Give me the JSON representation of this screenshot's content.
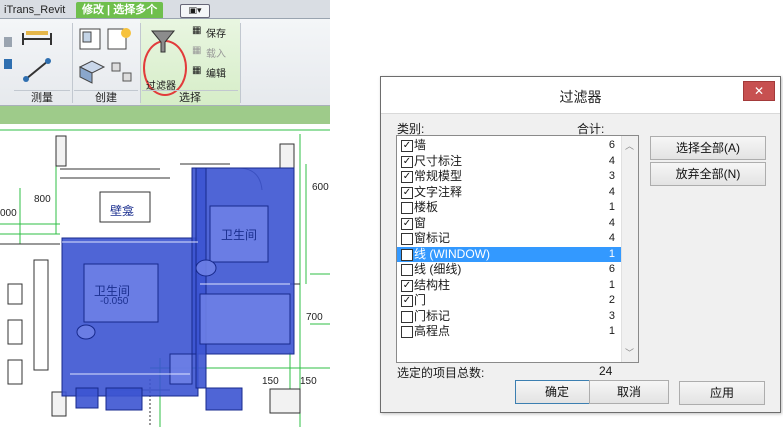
{
  "revit": {
    "tabs": {
      "addin": "iTrans_Revit",
      "modify": "修改 | 选择多个"
    },
    "ribbon": {
      "groups": {
        "measure": "测量",
        "create": "创建",
        "select": "选择"
      },
      "filter_label": "过滤器",
      "save_label": "保存",
      "load_label": "载入",
      "edit_label": "编辑"
    },
    "drawing": {
      "room_niche": "壁龛",
      "room_bath1": "卫生间",
      "room_bath2": "卫生间",
      "elev": "-0.050",
      "dim_800": "800",
      "dim_000": "000",
      "dim_600": "600",
      "dim_700": "700",
      "dim_150a": "150",
      "dim_150b": "150"
    }
  },
  "dialog": {
    "title": "过滤器",
    "close_glyph": "✕",
    "category_label": "类别:",
    "total_label": "合计:",
    "items": [
      {
        "name": "墙",
        "count": "6",
        "checked": true
      },
      {
        "name": "尺寸标注",
        "count": "4",
        "checked": true
      },
      {
        "name": "常规模型",
        "count": "3",
        "checked": true
      },
      {
        "name": "文字注释",
        "count": "4",
        "checked": true
      },
      {
        "name": "楼板",
        "count": "1",
        "checked": false
      },
      {
        "name": "窗",
        "count": "4",
        "checked": true
      },
      {
        "name": "窗标记",
        "count": "4",
        "checked": false
      },
      {
        "name": "线 (WINDOW)",
        "count": "1",
        "checked": false,
        "selected": true
      },
      {
        "name": "线 (细线)",
        "count": "6",
        "checked": false
      },
      {
        "name": "结构柱",
        "count": "1",
        "checked": true
      },
      {
        "name": "门",
        "count": "2",
        "checked": true
      },
      {
        "name": "门标记",
        "count": "3",
        "checked": false
      },
      {
        "name": "高程点",
        "count": "1",
        "checked": false
      }
    ],
    "total_items_label": "选定的项目总数:",
    "total_items_value": "24",
    "buttons": {
      "select_all": "选择全部(A)",
      "check_none": "放弃全部(N)",
      "ok": "确定",
      "cancel": "取消",
      "apply": "应用"
    }
  }
}
